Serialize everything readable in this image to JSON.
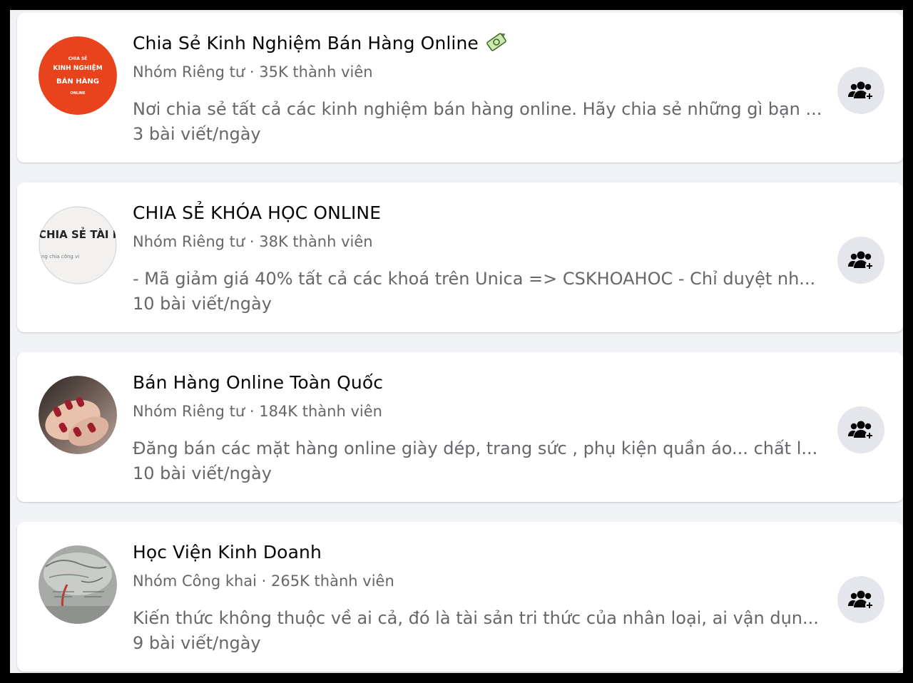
{
  "groups": [
    {
      "name": "Chia Sẻ Kinh Nghiệm Bán Hàng Online",
      "meta": "Nhóm Riêng tư · 35K thành viên",
      "description": "Nơi chia sẻ tất cả các kinh nghiệm bán hàng online. Hãy chia sẻ những gì bạn ...",
      "post_rate": "3 bài viết/ngày",
      "avatar_text": [
        "CHIA SẺ",
        "KINH NGHIỆM",
        "BÁN HÀNG",
        "ONLINE"
      ],
      "avatar_color": "#e8431c",
      "join_icon": "join-group-icon"
    },
    {
      "name": "CHIA SẺ KHÓA HỌC ONLINE",
      "meta": "Nhóm Riêng tư · 38K thành viên",
      "description": "- Mã giảm giá 40% tất cả các khoá trên Unica => CSKHOAHOC - Chỉ duyệt nh...",
      "post_rate": "10 bài viết/ngày",
      "avatar_text": [
        "CHIA SẺ TÀI N",
        "ng chia công vi"
      ],
      "join_icon": "join-group-icon"
    },
    {
      "name": "Bán Hàng Online Toàn Quốc",
      "meta": "Nhóm Riêng tư · 184K thành viên",
      "description": "Đăng bán các mặt hàng online giày dép, trang sức , phụ kiện quần áo... chất l...",
      "post_rate": "10 bài viết/ngày",
      "join_icon": "join-group-icon"
    },
    {
      "name": "Học Viện Kinh Doanh",
      "meta": "Nhóm Công khai · 265K thành viên",
      "description": "Kiến thức không thuộc về ai cả, đó là tài sản tri thức của nhân loại, ai vận dụn...",
      "post_rate": "9 bài viết/ngày",
      "join_icon": "join-group-icon"
    }
  ],
  "colors": {
    "card_bg": "#ffffff",
    "page_bg": "#f0f2f5",
    "primary_text": "#050505",
    "secondary_text": "#65676b",
    "button_bg": "#e4e6eb"
  }
}
